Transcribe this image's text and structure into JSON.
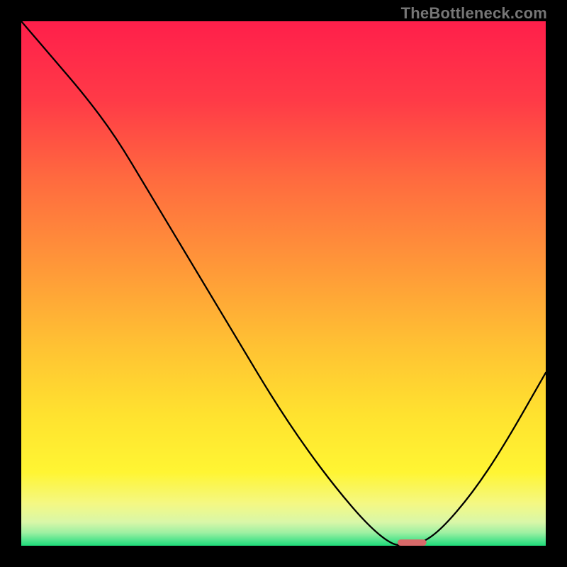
{
  "watermark": "TheBottleneck.com",
  "chart_data": {
    "type": "line",
    "title": "",
    "xlabel": "",
    "ylabel": "",
    "xlim": [
      0,
      1
    ],
    "ylim": [
      0,
      1
    ],
    "grid": false,
    "legend": false,
    "series": [
      {
        "name": "curve",
        "x": [
          0.0,
          0.06,
          0.12,
          0.18,
          0.24,
          0.3,
          0.36,
          0.42,
          0.48,
          0.54,
          0.6,
          0.66,
          0.705,
          0.73,
          0.76,
          0.8,
          0.86,
          0.92,
          1.0
        ],
        "y": [
          1.0,
          0.93,
          0.86,
          0.78,
          0.68,
          0.58,
          0.48,
          0.38,
          0.28,
          0.19,
          0.11,
          0.04,
          0.003,
          0.0,
          0.003,
          0.03,
          0.1,
          0.19,
          0.33
        ]
      }
    ],
    "gradient_stops": [
      {
        "offset": 0.0,
        "color": "#ff1f4b"
      },
      {
        "offset": 0.15,
        "color": "#ff3a47"
      },
      {
        "offset": 0.3,
        "color": "#ff6a3f"
      },
      {
        "offset": 0.48,
        "color": "#ff9b38"
      },
      {
        "offset": 0.62,
        "color": "#ffc233"
      },
      {
        "offset": 0.75,
        "color": "#ffe22f"
      },
      {
        "offset": 0.86,
        "color": "#fff533"
      },
      {
        "offset": 0.92,
        "color": "#f4f884"
      },
      {
        "offset": 0.955,
        "color": "#d9f7a8"
      },
      {
        "offset": 0.975,
        "color": "#9ef0a2"
      },
      {
        "offset": 0.99,
        "color": "#4fe48c"
      },
      {
        "offset": 1.0,
        "color": "#1edb79"
      }
    ],
    "marker": {
      "x_center": 0.745,
      "y_center": 0.0,
      "width": 0.055,
      "height": 0.012,
      "rx_frac": 0.006,
      "color": "#d86a6a"
    }
  }
}
